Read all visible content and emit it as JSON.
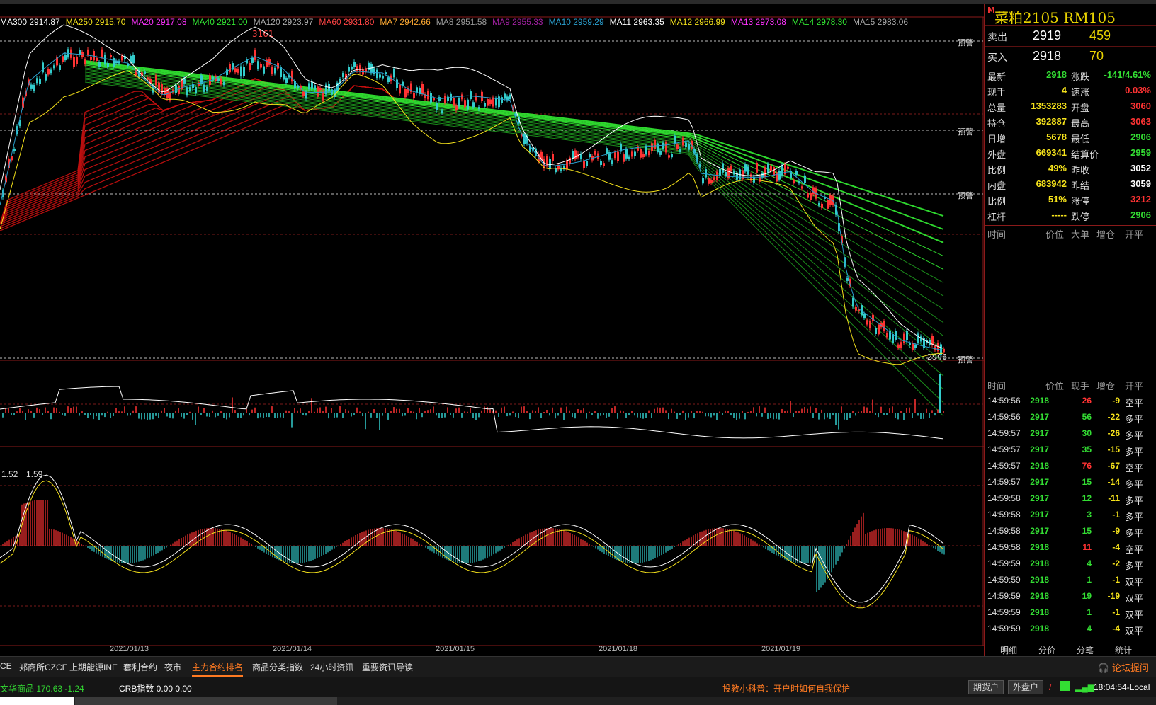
{
  "ma_legend": [
    {
      "label": "MA300 2914.87",
      "color": "#ffffff"
    },
    {
      "label": "MA250 2915.70",
      "color": "#f5e21b"
    },
    {
      "label": "MA20 2917.08",
      "color": "#ff33ff"
    },
    {
      "label": "MA40 2921.00",
      "color": "#33e833"
    },
    {
      "label": "MA120 2923.97",
      "color": "#aaaaaa"
    },
    {
      "label": "MA60 2931.80",
      "color": "#ff4444"
    },
    {
      "label": "MA7 2942.66",
      "color": "#ffaa33"
    },
    {
      "label": "MA8 2951.58",
      "color": "#999999"
    },
    {
      "label": "MA9 2955.33",
      "color": "#a020a0"
    },
    {
      "label": "MA10 2959.29",
      "color": "#2aa0d0"
    },
    {
      "label": "MA11 2963.35",
      "color": "#ffffff"
    },
    {
      "label": "MA12 2966.99",
      "color": "#f5e21b"
    },
    {
      "label": "MA13 2973.08",
      "color": "#ff33ff"
    },
    {
      "label": "MA14 2978.30",
      "color": "#33e833"
    },
    {
      "label": "MA15 2983.06",
      "color": "#aaaaaa"
    }
  ],
  "chart": {
    "high_label": "3161",
    "low_label": "2906",
    "warn_label": "预警",
    "macd_labels": [
      "1.52",
      "1.59"
    ],
    "dates": [
      "2021/01/13",
      "2021/01/14",
      "2021/01/15",
      "2021/01/18",
      "2021/01/19"
    ]
  },
  "contract": {
    "mark": "M",
    "title": "菜粕2105  RM105"
  },
  "quote": {
    "sell": {
      "label": "卖出",
      "price": "2919",
      "volume": "459"
    },
    "buy": {
      "label": "买入",
      "price": "2918",
      "volume": "70"
    }
  },
  "stats": [
    {
      "l1": "最新",
      "v1": "2918",
      "c1": "#33dd33",
      "l2": "涨跌",
      "v2": "-141/4.61%",
      "c2": "#33dd33"
    },
    {
      "l1": "现手",
      "v1": "4",
      "c1": "#f5e21b",
      "l2": "速涨",
      "v2": "0.03%",
      "c2": "#ff3333"
    },
    {
      "l1": "总量",
      "v1": "1353283",
      "c1": "#f5e21b",
      "l2": "开盘",
      "v2": "3060",
      "c2": "#ff3333"
    },
    {
      "l1": "持仓",
      "v1": "392887",
      "c1": "#f5e21b",
      "l2": "最高",
      "v2": "3063",
      "c2": "#ff3333"
    },
    {
      "l1": "日增",
      "v1": "5678",
      "c1": "#f5e21b",
      "l2": "最低",
      "v2": "2906",
      "c2": "#33dd33"
    },
    {
      "l1": "外盘",
      "v1": "669341",
      "c1": "#f5e21b",
      "l2": "结算价",
      "v2": "2959",
      "c2": "#33dd33"
    },
    {
      "l1": "比例",
      "v1": "49%",
      "c1": "#f5e21b",
      "l2": "昨收",
      "v2": "3052",
      "c2": "#ffffff"
    },
    {
      "l1": "内盘",
      "v1": "683942",
      "c1": "#f5e21b",
      "l2": "昨结",
      "v2": "3059",
      "c2": "#ffffff"
    },
    {
      "l1": "比例",
      "v1": "51%",
      "c1": "#f5e21b",
      "l2": "涨停",
      "v2": "3212",
      "c2": "#ff3333"
    },
    {
      "l1": "杠杆",
      "v1": "-----",
      "c1": "#f5e21b",
      "l2": "跌停",
      "v2": "2906",
      "c2": "#33dd33"
    }
  ],
  "big_order_header": [
    "时间",
    "价位",
    "大单",
    "增仓",
    "开平"
  ],
  "tick_header": [
    "时间",
    "价位",
    "现手",
    "增仓",
    "开平"
  ],
  "ticks": [
    {
      "t": "14:59:56",
      "p": "2918",
      "pc": "#33dd33",
      "v": "26",
      "vc": "#ff3333",
      "c": "-9",
      "o": "空平"
    },
    {
      "t": "14:59:56",
      "p": "2917",
      "pc": "#33dd33",
      "v": "56",
      "vc": "#33dd33",
      "c": "-22",
      "o": "多平"
    },
    {
      "t": "14:59:57",
      "p": "2917",
      "pc": "#33dd33",
      "v": "30",
      "vc": "#33dd33",
      "c": "-26",
      "o": "多平"
    },
    {
      "t": "14:59:57",
      "p": "2917",
      "pc": "#33dd33",
      "v": "35",
      "vc": "#33dd33",
      "c": "-15",
      "o": "多平"
    },
    {
      "t": "14:59:57",
      "p": "2918",
      "pc": "#33dd33",
      "v": "76",
      "vc": "#ff3333",
      "c": "-67",
      "o": "空平"
    },
    {
      "t": "14:59:57",
      "p": "2917",
      "pc": "#33dd33",
      "v": "15",
      "vc": "#33dd33",
      "c": "-14",
      "o": "多平"
    },
    {
      "t": "14:59:58",
      "p": "2917",
      "pc": "#33dd33",
      "v": "12",
      "vc": "#33dd33",
      "c": "-11",
      "o": "多平"
    },
    {
      "t": "14:59:58",
      "p": "2917",
      "pc": "#33dd33",
      "v": "3",
      "vc": "#33dd33",
      "c": "-1",
      "o": "多平"
    },
    {
      "t": "14:59:58",
      "p": "2917",
      "pc": "#33dd33",
      "v": "15",
      "vc": "#33dd33",
      "c": "-9",
      "o": "多平"
    },
    {
      "t": "14:59:58",
      "p": "2918",
      "pc": "#33dd33",
      "v": "11",
      "vc": "#ff3333",
      "c": "-4",
      "o": "空平"
    },
    {
      "t": "14:59:59",
      "p": "2918",
      "pc": "#33dd33",
      "v": "4",
      "vc": "#33dd33",
      "c": "-2",
      "o": "多平"
    },
    {
      "t": "14:59:59",
      "p": "2918",
      "pc": "#33dd33",
      "v": "1",
      "vc": "#33dd33",
      "c": "-1",
      "o": "双平"
    },
    {
      "t": "14:59:59",
      "p": "2918",
      "pc": "#33dd33",
      "v": "19",
      "vc": "#33dd33",
      "c": "-19",
      "o": "双平"
    },
    {
      "t": "14:59:59",
      "p": "2918",
      "pc": "#33dd33",
      "v": "1",
      "vc": "#33dd33",
      "c": "-1",
      "o": "双平"
    },
    {
      "t": "14:59:59",
      "p": "2918",
      "pc": "#33dd33",
      "v": "4",
      "vc": "#33dd33",
      "c": "-4",
      "o": "双平"
    }
  ],
  "side_tabs": [
    "明细",
    "分价",
    "分笔",
    "统计"
  ],
  "nav_tabs": [
    "CE",
    "郑商所CZCE",
    "上期能源INE",
    "套利合约",
    "夜市",
    "主力合约排名",
    "商品分类指数",
    "24小时资讯",
    "重要资讯导读"
  ],
  "active_nav": "主力合约排名",
  "forum": "论坛提问",
  "status": {
    "index": "文华商品  170.63  -1.24",
    "crb": "CRB指数   0.00  0.00",
    "promo": "投教小科普：开户时如何自我保护",
    "btn1": "期货户",
    "btn2": "外盘户",
    "time": "18:04:54-Local"
  }
}
